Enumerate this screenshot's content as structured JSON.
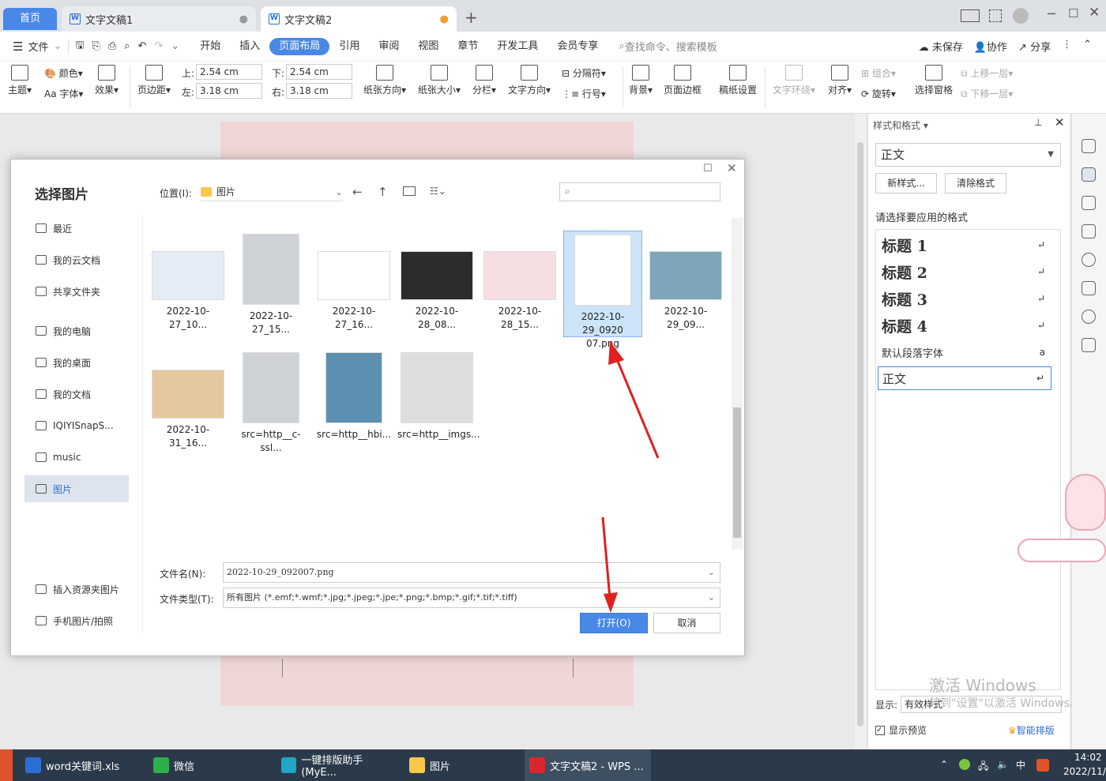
{
  "tabs": {
    "home": "首页",
    "doc1": "文字文稿1",
    "doc2": "文字文稿2",
    "add": "+"
  },
  "menu": {
    "file": "文件",
    "items": [
      "开始",
      "插入",
      "页面布局",
      "引用",
      "审阅",
      "视图",
      "章节",
      "开发工具",
      "会员专享"
    ],
    "search": "查找命令、搜索模板",
    "unsaved": "未保存",
    "collab": "协作",
    "share": "分享"
  },
  "ribbon": {
    "theme": "主题",
    "color": "颜色",
    "font": "字体",
    "effect": "效果",
    "margin": "页边距",
    "top_label": "上:",
    "top_val": "2.54 cm",
    "bottom_label": "下:",
    "bottom_val": "2.54 cm",
    "left_label": "左:",
    "left_val": "3.18 cm",
    "right_label": "右:",
    "right_val": "3.18 cm",
    "orient": "纸张方向",
    "size": "纸张大小",
    "cols": "分栏",
    "textdir": "文字方向",
    "sep": "分隔符",
    "lineno": "行号",
    "bg": "背景",
    "border": "页面边框",
    "paper": "稿纸设置",
    "wrap": "文字环绕",
    "align": "对齐",
    "group": "组合",
    "rotate": "旋转",
    "pane": "选择窗格",
    "up": "上移一层",
    "down": "下移一层"
  },
  "dialog": {
    "title": "选择图片",
    "loc_label": "位置(I):",
    "loc_value": "图片",
    "nav": [
      "最近",
      "我的云文档",
      "共享文件夹",
      "我的电脑",
      "我的桌面",
      "我的文档",
      "IQIYISnapS...",
      "music",
      "图片"
    ],
    "nav_bottom": [
      "插入资源夹图片",
      "手机图片/拍照"
    ],
    "files": [
      "2022-10-27_10...",
      "2022-10-27_15...",
      "2022-10-27_16...",
      "2022-10-28_08...",
      "2022-10-28_15...",
      "2022-10-29_0920\n07.png",
      "2022-10-29_09...",
      "2022-10-31_16...",
      "src=http__c-ssl...",
      "src=http__hbi...",
      "src=http__imgs..."
    ],
    "filename_label": "文件名(N):",
    "filename_value": "2022-10-29_092007.png",
    "filetype_label": "文件类型(T):",
    "filetype_value": "所有图片 (*.emf;*.wmf;*.jpg;*.jpeg;*.jpe;*.png;*.bmp;*.gif;*.tif;*.tiff)",
    "open": "打开(O)",
    "cancel": "取消"
  },
  "panel": {
    "title": "样式和格式",
    "current": "正文",
    "new_style": "新样式...",
    "clear": "清除格式",
    "prompt": "请选择要应用的格式",
    "styles": [
      "标题  1",
      "标题  2",
      "标题  3",
      "标题  4"
    ],
    "default_font": "默认段落字体",
    "body": "正文",
    "show_label": "显示:",
    "show_value": "有效样式",
    "preview": "显示预览",
    "smart": "智能排版"
  },
  "watermark": {
    "line1": "激活 Windows",
    "line2": "转到\"设置\"以激活 Windows。"
  },
  "taskbar": {
    "items": [
      "word关键词.xls",
      "微信",
      "一键排版助手(MyE...",
      "图片",
      "文字文稿2 - WPS ..."
    ],
    "time": "14:02",
    "date": "2022/11/",
    "ime": "中"
  },
  "colors": {
    "accent": "#4a88e8",
    "arrow": "#e02020",
    "page": "#efd6d5"
  }
}
